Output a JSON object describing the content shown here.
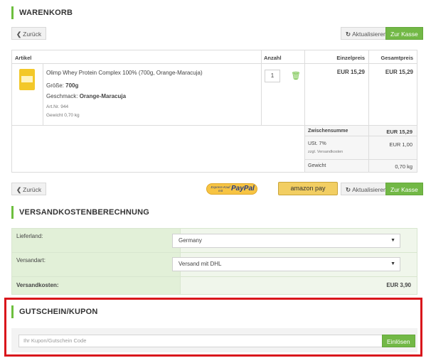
{
  "cart": {
    "title": "WARENKORB",
    "back_label": "Zurück",
    "refresh_label": "Aktualisieren",
    "checkout_label": "Zur Kasse",
    "columns": {
      "article": "Artikel",
      "qty": "Anzahl",
      "unit_price": "Einzelpreis",
      "total_price": "Gesamtpreis"
    },
    "item": {
      "name": "Olimp Whey Protein Complex 100% (700g, Orange-Maracuja)",
      "size_label": "Größe:",
      "size_value": "700g",
      "flavor_label": "Geschmack:",
      "flavor_value": "Orange-Maracuja",
      "art_nr": "Art.Nr. 944",
      "weight": "Gewicht 0,70 kg",
      "qty": "1",
      "unit_price": "EUR 15,29",
      "total_price": "EUR 15,29"
    },
    "totals": {
      "subtotal_label": "Zwischensumme",
      "subtotal_value": "EUR 15,29",
      "vat_label": "USt. 7%",
      "vat_sub": "zzgl. Versandkosten",
      "vat_value": "EUR 1,00",
      "weight_label": "Gewicht",
      "weight_value": "0,70 kg"
    },
    "paypal_small": "Express-Kauf mit",
    "paypal_main": "PayPal",
    "amazon_label": "amazon pay"
  },
  "shipping": {
    "title": "VERSANDKOSTENBERECHNUNG",
    "country_label": "Lieferland:",
    "country_value": "Germany",
    "method_label": "Versandart:",
    "method_value": "Versand mit DHL",
    "cost_label": "Versandkosten:",
    "cost_value": "EUR 3,90"
  },
  "coupon": {
    "title": "GUTSCHEIN/KUPON",
    "placeholder": "Ihr Kupon/Gutschein Code",
    "submit_label": "Einlösen"
  },
  "colors": {
    "accent": "#72b846",
    "highlight": "#d9161c"
  }
}
